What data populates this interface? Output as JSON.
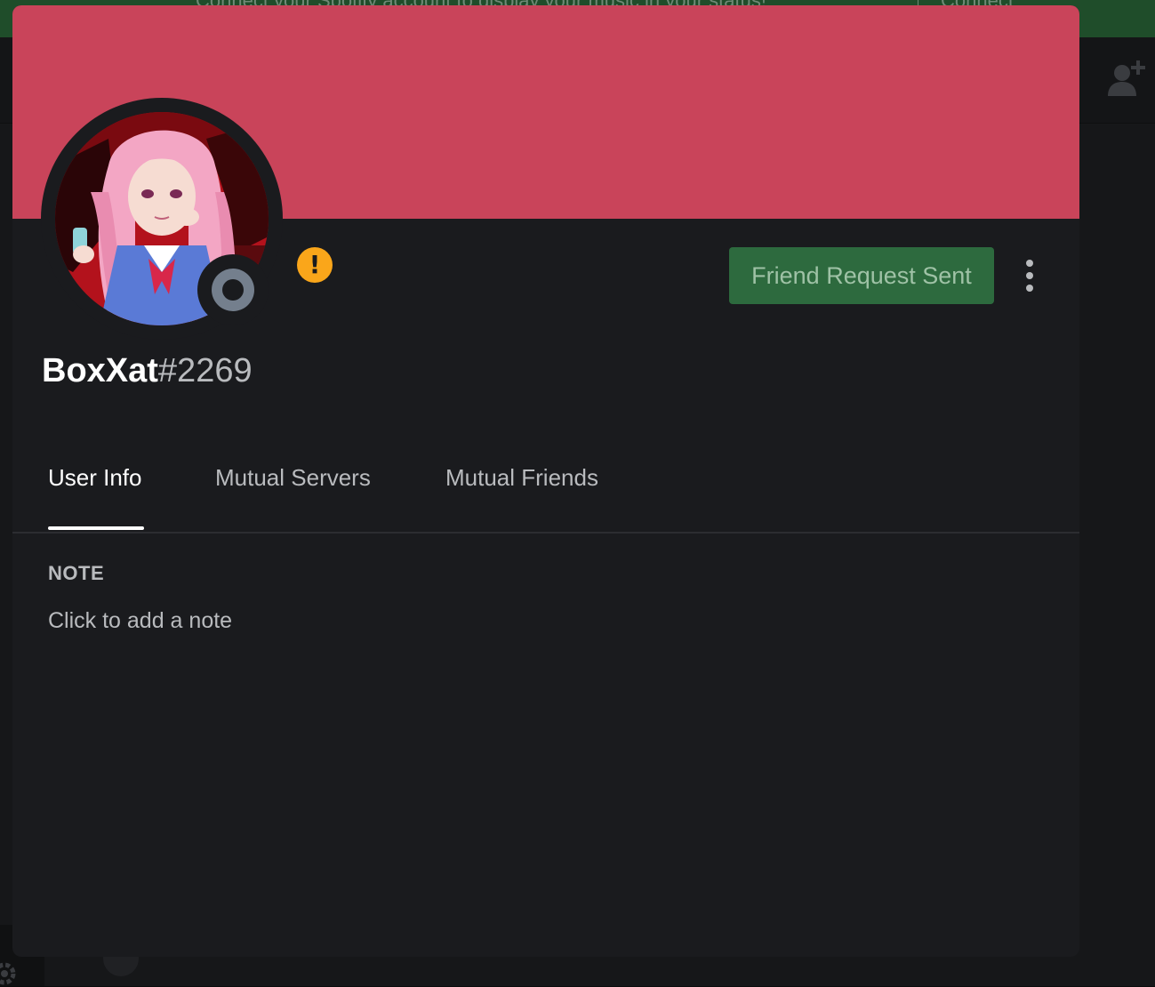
{
  "background": {
    "topbar_text": "Connect your Spotify account to display your music in your status!",
    "topbar_button": "Connect",
    "add_friend_icon": "person-add-icon",
    "gear_icon": "gear-icon"
  },
  "profile": {
    "banner_color": "#c9445a",
    "avatar_icon": "avatar-image",
    "status": "offline",
    "status_color": "#747f8d",
    "warning_glyph": "!",
    "warning_color": "#faa61a",
    "username": "BoxXat",
    "discriminator": "#2269",
    "friend_button_label": "Friend Request Sent",
    "friend_button_color": "#2d6a3e",
    "more_icon": "more-vertical-icon"
  },
  "tabs": [
    {
      "label": "User Info",
      "active": true
    },
    {
      "label": "Mutual Servers",
      "active": false
    },
    {
      "label": "Mutual Friends",
      "active": false
    }
  ],
  "note": {
    "heading": "NOTE",
    "placeholder": "Click to add a note",
    "value": ""
  }
}
